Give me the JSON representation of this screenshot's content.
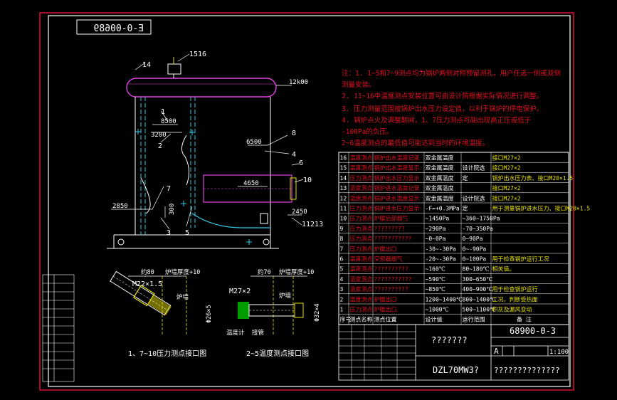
{
  "drawing_number_top": "E-0-00689",
  "drawing_number": "68900-0-3",
  "model": "DZL70MW3?",
  "title_placeholder": "???????",
  "company_placeholder": "??????????????",
  "revision": "A",
  "scale": "1:100",
  "remark_header": "备 注",
  "dims": {
    "d1": "12k00",
    "d2": "8500",
    "d3": "3200",
    "d4": "6500",
    "d5": "4650",
    "d6": "2850",
    "d7": "300",
    "d8": "2450"
  },
  "callouts": {
    "c1": "1516",
    "c2": "14",
    "c3": "1",
    "c4": "2",
    "c5": "8",
    "c6": "4",
    "c7": "6",
    "c8": "10",
    "c9": "7",
    "c10": "3",
    "c11": "5",
    "c12": "11213"
  },
  "notes": [
    "注：1. 1~5和7~9测点均为锅炉两侧对称预留测孔，用户任选一侧或双侧",
    "    测量安装。",
    "    2. 11~16中温度测点安装位置可由设计院根据实际情况进行调整。",
    "    3. 压力测量范围按锅炉出水压力设定值，以利于锅炉的停电保护。",
    "    4. 锅炉点火及调整期间，1、7压力测点可能出现高正压或低于",
    "-100Pa的负压。",
    "        2~6温度测点的最低值可能达到当时的环境温度。"
  ],
  "table_rows": [
    {
      "no": "16",
      "type": "温度测点",
      "name": "锅炉出水温度记录",
      "meter": "双金属温度",
      "range": "",
      "remark": "接口M27×2"
    },
    {
      "no": "15",
      "type": "温度测点",
      "name": "锅炉出水温度显示",
      "meter": "双金属温度",
      "range": "设计院选",
      "remark": "接口M27×2"
    },
    {
      "no": "14",
      "type": "压力测点",
      "name": "锅炉出水压力显示",
      "meter": "双金属温度",
      "range": "定",
      "remark": "锅炉出水压力表、接口M20×1.5"
    },
    {
      "no": "13",
      "type": "温度测点",
      "name": "锅炉进水温度记录",
      "meter": "双金属温度",
      "range": "",
      "remark": "接口M27×2"
    },
    {
      "no": "12",
      "type": "温度测点",
      "name": "锅炉进水温度显示",
      "meter": "双金属温度",
      "range": "设计院选",
      "remark": "接口M27×2"
    },
    {
      "no": "11",
      "type": "压力测点",
      "name": "锅炉进水压力显示",
      "meter": "-F=+0.3MPa",
      "range": "定",
      "remark": "用于测量锅炉进水压力、接口M20×1.5"
    },
    {
      "no": "10",
      "type": "压力测点",
      "name": "炉膛后部烟气",
      "meter": "~1450Pa",
      "range": "~360~1750Pa",
      "remark": ""
    },
    {
      "no": "9",
      "type": "压力测点",
      "name": "?????????",
      "meter": "~290Pa",
      "range": "-70~350Pa",
      "remark": ""
    },
    {
      "no": "8",
      "type": "压力测点",
      "name": "???????????",
      "meter": "~0~0Pa",
      "range": "0~90Pa",
      "remark": ""
    },
    {
      "no": "7",
      "type": "压力测点",
      "name": "炉膛出口",
      "meter": "-30~-30Pa",
      "range": "0~-90Pa",
      "remark": ""
    },
    {
      "no": "6",
      "type": "温度测点",
      "name": "空预器烟气",
      "meter": "-20~-30Pa",
      "range": "0~100Pa",
      "remark": "用于检查锅炉运行工况"
    },
    {
      "no": "5",
      "type": "温度测点",
      "name": "??????????",
      "meter": "~160℃",
      "range": "80~180℃",
      "remark": "相关值。"
    },
    {
      "no": "4",
      "type": "温度测点",
      "name": "???????????",
      "meter": "~590℃",
      "range": "300~650℃",
      "remark": ""
    },
    {
      "no": "3",
      "type": "温度测点",
      "name": "??????????",
      "meter": "~850℃",
      "range": "400~900℃",
      "remark": "用于检查锅炉运行"
    },
    {
      "no": "2",
      "type": "温度测点",
      "name": "炉膛出口",
      "meter": "1200~1400℃",
      "range": "800~1400℃",
      "remark": "工况，判断受热面"
    },
    {
      "no": "1",
      "type": "压力测点",
      "name": "炉膛出口",
      "meter": "~1000℃",
      "range": "500~1100℃",
      "remark": "积灰及漏风变动"
    }
  ],
  "table_header": {
    "no": "序号",
    "type": "测点名称",
    "name": "测点位置",
    "meter": "设计值",
    "range": "运行范围"
  },
  "detail1": {
    "title": "1、7~10压力测点接口图",
    "thread": "M22×1.5",
    "label_a": "约80",
    "label_b": "炉墙厚度+10",
    "label_c": "炉墙",
    "dia": "Φ26×5"
  },
  "detail2": {
    "title": "2~5温度测点接口图",
    "thread": "M27×2",
    "label_a": "约70",
    "label_b": "炉墙厚度+10",
    "label_c": "炉墙",
    "dia": "Φ32×4",
    "label_d": "温度计",
    "label_e": "接管"
  },
  "colors": {
    "border": "#d01030",
    "frame": "#ffffff",
    "green": "#00d000",
    "yellow": "#e8e000",
    "cyan": "#30c8e0",
    "magenta": "#e040e0",
    "notes": "#e01020"
  }
}
